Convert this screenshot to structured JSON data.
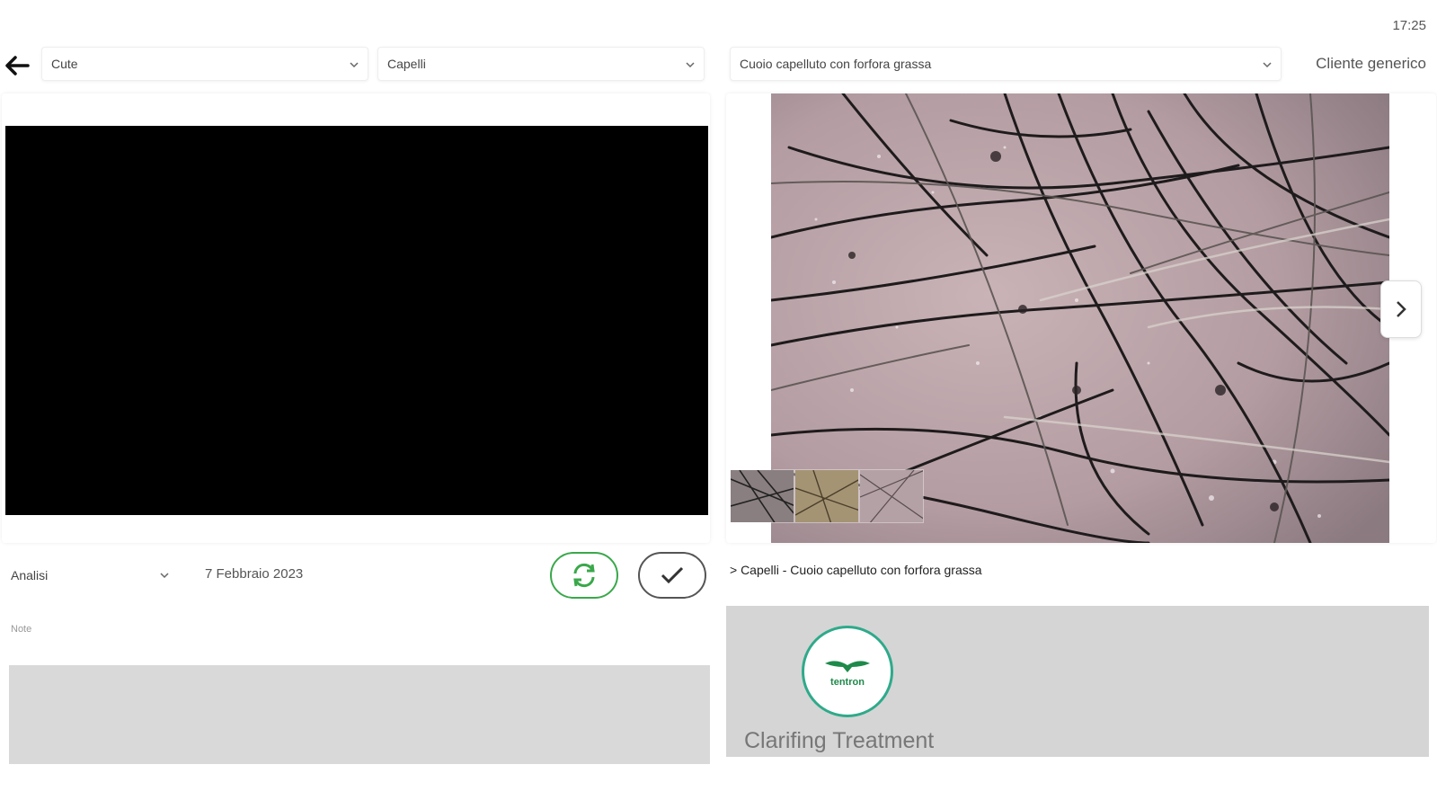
{
  "status": {
    "time": "17:25"
  },
  "toolbar": {
    "back_icon": "arrow-left-icon",
    "select_area": {
      "value": "Cute"
    },
    "select_type": {
      "value": "Capelli"
    },
    "select_condition": {
      "value": "Cuoio capelluto con forfora grassa"
    },
    "client_name": "Cliente generico"
  },
  "capture": {
    "analysis_select": {
      "value": "Analisi"
    },
    "date": "7 Febbraio 2023",
    "refresh_icon": "refresh-icon",
    "confirm_icon": "check-icon",
    "note_label": "Note",
    "note_value": ""
  },
  "reference": {
    "thumbnails_count": 3,
    "next_icon": "chevron-right-icon",
    "breadcrumb": "> Capelli - Cuoio capelluto con forfora grassa",
    "treatment_name": "Clarifing Treatment",
    "logo_text": "tentron"
  },
  "colors": {
    "accent_green": "#3aa84a",
    "logo_ring": "#2eaa8a",
    "panel_gray": "#d5d5d5"
  }
}
